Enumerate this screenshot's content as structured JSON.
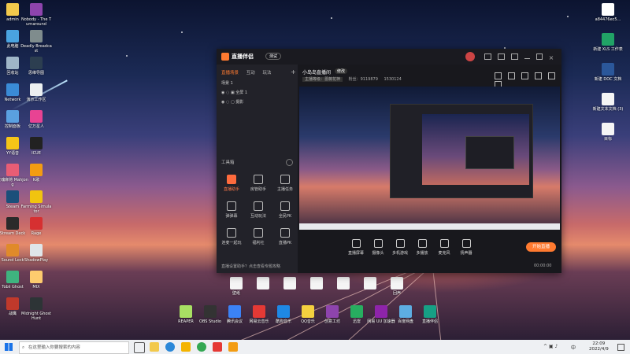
{
  "desktop": {
    "left_icons": [
      {
        "label": "admin",
        "color": "#f2c94c"
      },
      {
        "label": "此电脑",
        "color": "#4aa3df"
      },
      {
        "label": "回收站",
        "color": "#9fb6c8"
      },
      {
        "label": "Network",
        "color": "#3a8bd6"
      },
      {
        "label": "控制面板",
        "color": "#5aa0e0"
      },
      {
        "label": "YY语音",
        "color": "#f5c518"
      },
      {
        "label": "雀魂麻将 Mahjong",
        "color": "#e85d75"
      },
      {
        "label": "Steam",
        "color": "#1b4f7a"
      },
      {
        "label": "Stream Deck",
        "color": "#2a2a2a"
      },
      {
        "label": "Sound Lock",
        "color": "#e08a2a"
      },
      {
        "label": "Tobii Ghost",
        "color": "#3fb37f"
      },
      {
        "label": "战鹰",
        "color": "#c0392b"
      }
    ],
    "col2_icons": [
      {
        "label": "Nobody - The Turnaround",
        "color": "#8e44ad"
      },
      {
        "label": "Deadly Broadcast",
        "color": "#7f8c8d"
      },
      {
        "label": "思维导图",
        "color": "#2c3e50"
      },
      {
        "label": "演示工作区",
        "color": "#ecf0f1"
      },
      {
        "label": "亿万星人",
        "color": "#e84393"
      },
      {
        "label": "ICUE",
        "color": "#222222"
      },
      {
        "label": "K歌",
        "color": "#f39c12"
      },
      {
        "label": "Farming Simulator",
        "color": "#f1c40f"
      },
      {
        "label": "Rage",
        "color": "#d63031"
      },
      {
        "label": "ShadowPlay",
        "color": "#dfe6e9"
      },
      {
        "label": "MIX",
        "color": "#fdcb6e"
      },
      {
        "label": "Midnight Ghost Hunt",
        "color": "#2d3436"
      }
    ],
    "right_icons": [
      {
        "label": "a84476ec5...",
        "color": "#ffffff"
      },
      {
        "label": "新建 XLS 工作表",
        "color": "#21a366"
      },
      {
        "label": "新建 DOC 文档",
        "color": "#2b579a"
      },
      {
        "label": "新建文本文档 (3)",
        "color": "#f5f5f5"
      },
      {
        "label": "目标",
        "color": "#f5f5f5"
      }
    ],
    "bottom_icons": [
      {
        "label": "REAPER",
        "color": "#a8e063"
      },
      {
        "label": "OBS Studio",
        "color": "#333333"
      },
      {
        "label": "腾讯会议",
        "color": "#3b82f6"
      },
      {
        "label": "网易云音乐",
        "color": "#e53935"
      },
      {
        "label": "酷狗音乐",
        "color": "#1e88e5"
      },
      {
        "label": "QQ音乐",
        "color": "#f4d03f"
      },
      {
        "label": "创意工坊",
        "color": "#8e44ad"
      },
      {
        "label": "迅雷",
        "color": "#27ae60"
      },
      {
        "label": "网易 UU 加速器",
        "color": "#8e24aa"
      },
      {
        "label": "百度网盘",
        "color": "#5dade2"
      },
      {
        "label": "直播伴侣",
        "color": "#16a085"
      }
    ],
    "mid_icons": [
      "壁纸",
      "",
      "",
      "",
      "",
      "",
      "回声"
    ]
  },
  "window": {
    "app_name": "直播伴侣",
    "badge": "测试",
    "left_tabs": [
      "直播场景",
      "互动",
      "玩法"
    ],
    "scene_label": "场景 1",
    "sources": [
      "全屏 1",
      "摄影"
    ],
    "tools_title": "工具箱",
    "tools": [
      {
        "label": "直播助手",
        "active": true
      },
      {
        "label": "房管助手",
        "active": false
      },
      {
        "label": "主播任务",
        "active": false
      },
      {
        "label": "弹弹幕",
        "active": false
      },
      {
        "label": "互动玩法",
        "active": false
      },
      {
        "label": "全民PK",
        "active": false
      },
      {
        "label": "连麦一起玩",
        "active": false
      },
      {
        "label": "福利社",
        "active": false
      },
      {
        "label": "直播PK",
        "active": false
      }
    ],
    "footer_hint": "直播设置助手？点击查看专题攻略",
    "room_title": "小岛岛直播间",
    "room_tag": "修改",
    "meta": [
      "主播等级：蔷薇花神",
      "粉丝：9119879",
      "1530124"
    ],
    "controls": [
      {
        "label": "直播屏幕"
      },
      {
        "label": "摄像头"
      },
      {
        "label": "多机游戏"
      },
      {
        "label": "多播放"
      },
      {
        "label": "麦克风"
      },
      {
        "label": "扬声器"
      }
    ],
    "go_live": "开始直播",
    "duration": "00:00:00"
  },
  "taskbar": {
    "search_placeholder": "在这里输入你要搜索的内容",
    "time": "22:09",
    "date": "2022/4/9",
    "lang": "中"
  }
}
